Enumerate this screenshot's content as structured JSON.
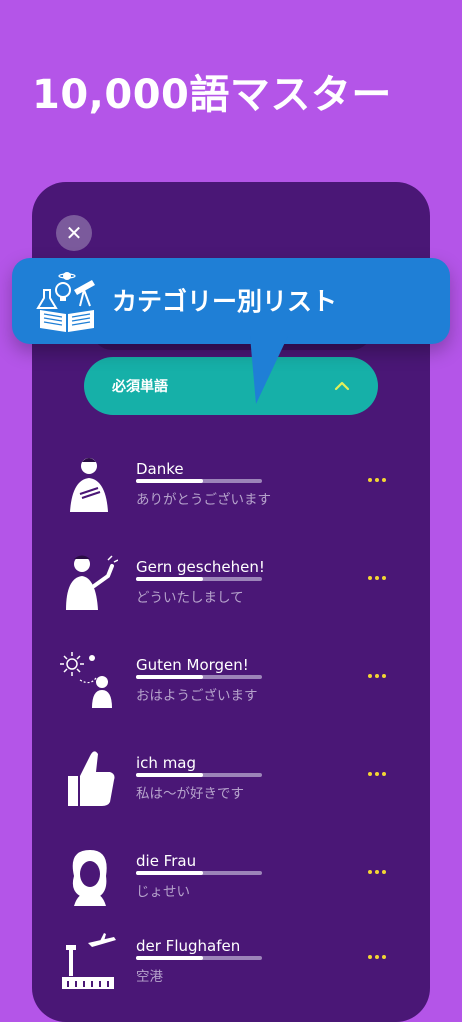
{
  "headline": "10,000語マスター",
  "close_button": {
    "icon": "close-icon"
  },
  "tooltip": {
    "title": "カテゴリー別リスト",
    "icon": "science-book-icon"
  },
  "category": {
    "label": "必須単語",
    "icon": "chevron-up-icon",
    "accent": "#16b0a8"
  },
  "words": [
    {
      "term": "Danke",
      "translation": "ありがとうございます",
      "illustration": "person-thanking-icon",
      "progress": 0.53
    },
    {
      "term": "Gern geschehen!",
      "translation": "どういたしまして",
      "illustration": "person-pointing-icon",
      "progress": 0.53
    },
    {
      "term": "Guten Morgen!",
      "translation": "おはようございます",
      "illustration": "morning-sun-person-icon",
      "progress": 0.53
    },
    {
      "term": "ich mag",
      "translation": "私は〜が好きです",
      "illustration": "thumbs-up-icon",
      "progress": 0.53
    },
    {
      "term": "die Frau",
      "translation": "じょせい",
      "illustration": "woman-portrait-icon",
      "progress": 0.53
    },
    {
      "term": "der Flughafen",
      "translation": "空港",
      "illustration": "airport-icon",
      "progress": 0.53
    }
  ],
  "colors": {
    "background": "#b455e8",
    "card": "#4a1776",
    "tooltip": "#1f7fd6",
    "more_dots": "#f3d633"
  }
}
